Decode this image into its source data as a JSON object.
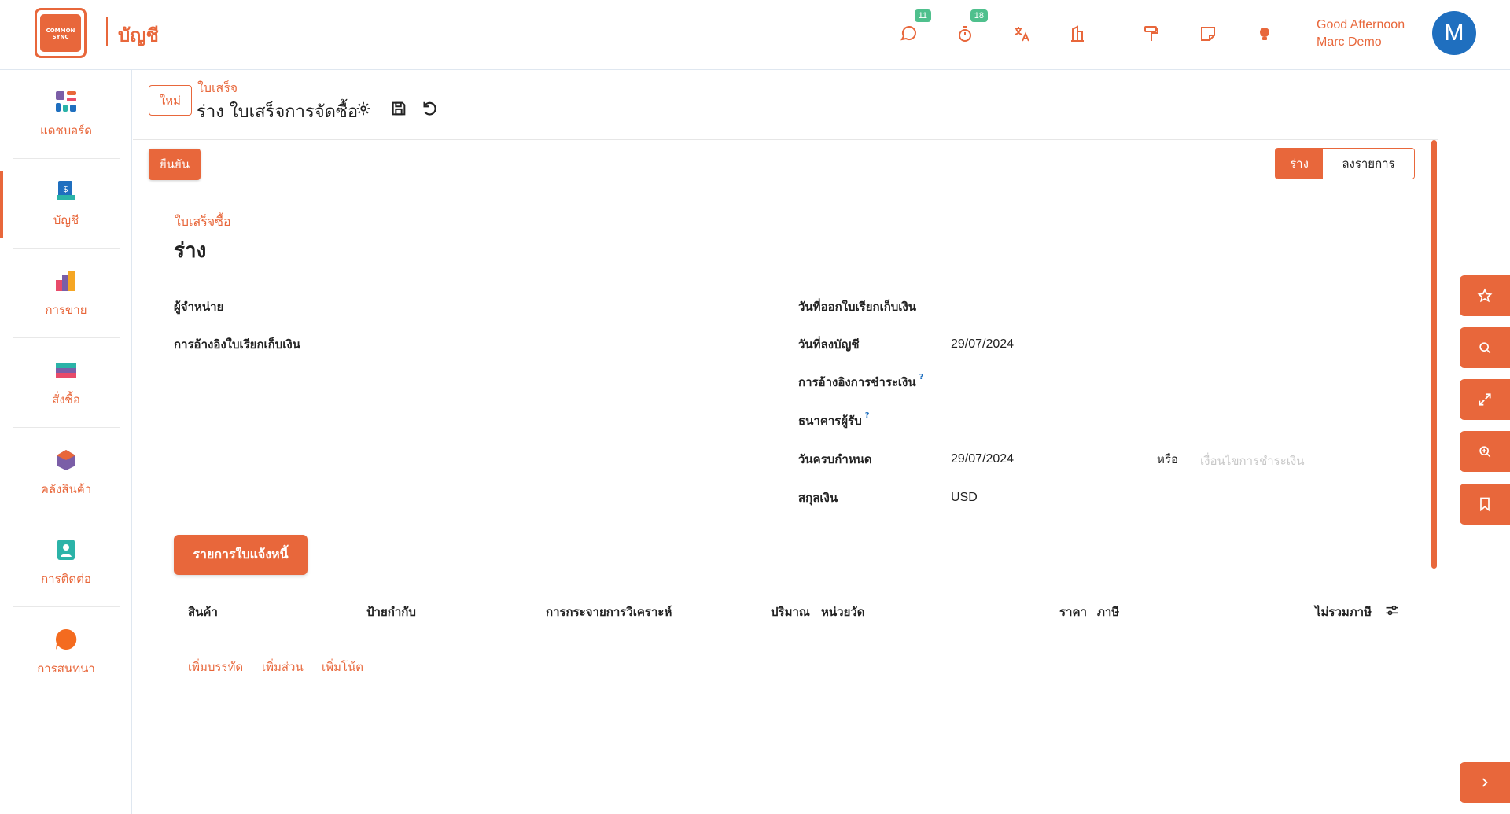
{
  "brand": {
    "logo_text": "COMMON SYNC",
    "app_name": "บัญชี"
  },
  "topbar": {
    "chat_badge": "11",
    "timer_badge": "18",
    "greeting": "Good Afternoon",
    "user_name": "Marc Demo",
    "avatar_initial": "M"
  },
  "sidebar": {
    "items": [
      {
        "label": "แดชบอร์ด",
        "icon": "dashboard-icon"
      },
      {
        "label": "บัญชี",
        "icon": "accounting-icon"
      },
      {
        "label": "การขาย",
        "icon": "sales-icon"
      },
      {
        "label": "สั่งซื้อ",
        "icon": "purchase-icon"
      },
      {
        "label": "คลังสินค้า",
        "icon": "inventory-icon"
      },
      {
        "label": "การติดต่อ",
        "icon": "contacts-icon"
      },
      {
        "label": "การสนทนา",
        "icon": "discuss-icon"
      }
    ]
  },
  "breadcrumb": {
    "new_button": "ใหม่",
    "parent": "ใบเสร็จ",
    "title": "ร่าง ใบเสร็จการจัดซื้อ"
  },
  "actions": {
    "confirm": "ยืนยัน"
  },
  "status": {
    "draft": "ร่าง",
    "posted": "ลงรายการ"
  },
  "form": {
    "subtitle": "ใบเสร็จซื้อ",
    "title": "ร่าง",
    "vendor_label": "ผู้จำหน่าย",
    "bill_ref_label": "การอ้างอิงใบเรียกเก็บเงิน",
    "invoice_date_label": "วันที่ออกใบเรียกเก็บเงิน",
    "accounting_date_label": "วันที่ลงบัญชี",
    "accounting_date_value": "29/07/2024",
    "payment_ref_label": "การอ้างอิงการชำระเงิน",
    "recipient_bank_label": "ธนาคารผู้รับ",
    "help_mark": "?",
    "due_date_label": "วันครบกำหนด",
    "due_date_value": "29/07/2024",
    "or_label": "หรือ",
    "payment_terms_placeholder": "เงื่อนไขการชำระเงิน",
    "currency_label": "สกุลเงิน",
    "currency_value": "USD"
  },
  "lines": {
    "tab_label": "รายการใบแจ้งหนี้",
    "columns": [
      "สินค้า",
      "ป้ายกำกับ",
      "การกระจายการวิเคราะห์",
      "ปริมาณ",
      "หน่วยวัด",
      "ราคา",
      "ภาษี",
      "ไม่รวมภาษี"
    ],
    "add_line": "เพิ่มบรรทัด",
    "add_section": "เพิ่มส่วน",
    "add_note": "เพิ่มโน้ต"
  },
  "colors": {
    "accent": "#e8673b",
    "badge": "#4fc08d",
    "avatar": "#1f6fbf"
  }
}
